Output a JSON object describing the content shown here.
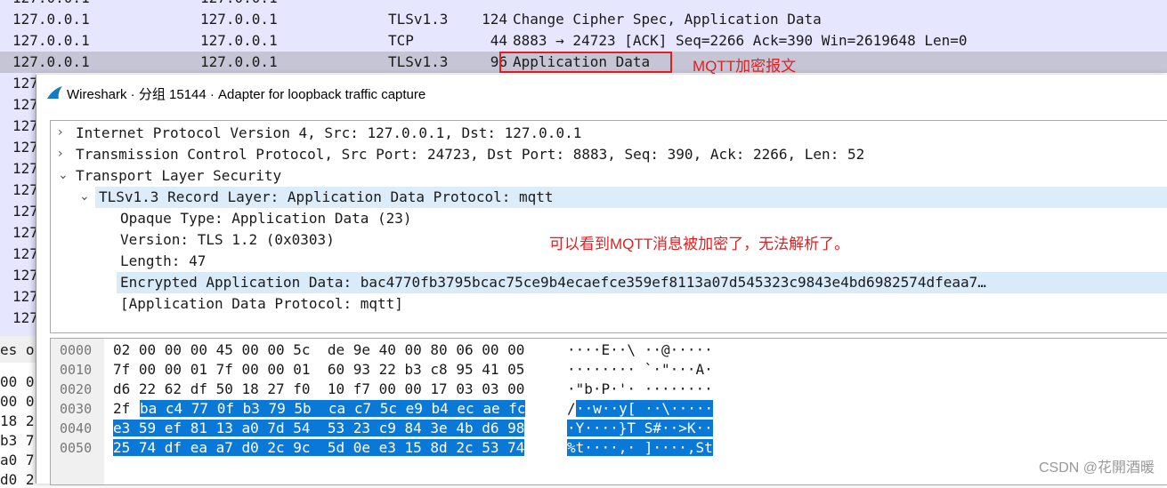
{
  "packet_list": {
    "rows": [
      {
        "src": "127.0.0.1",
        "dst": "127.0.0.1",
        "proto": "TLSv1.3",
        "len": "124",
        "info": "Change Cipher Spec, Application Data"
      },
      {
        "src": "127.0.0.1",
        "dst": "127.0.0.1",
        "proto": "TCP",
        "len": "44",
        "info": "8883 → 24723 [ACK] Seq=2266 Ack=390 Win=2619648 Len=0"
      },
      {
        "src": "127.0.0.1",
        "dst": "127.0.0.1",
        "proto": "TLSv1.3",
        "len": "96",
        "info": "Application Data"
      }
    ],
    "left_fragments": [
      "127",
      "127",
      "127",
      "127",
      "127",
      "127",
      "127",
      "127",
      "127",
      "127",
      "127"
    ],
    "bytes_fragments": [
      "es o",
      "00 0",
      "00 0",
      "18 2",
      "b3 7",
      "a0 7",
      "d0 2"
    ]
  },
  "annotations": {
    "mqtt_label": "MQTT加密报文",
    "encrypted_note": "可以看到MQTT消息被加密了，无法解析了。"
  },
  "dialog": {
    "title": "Wireshark · 分组 15144 · Adapter for loopback traffic capture"
  },
  "tree": [
    {
      "indent": 0,
      "chevron": "›",
      "text": "Internet Protocol Version 4, Src: 127.0.0.1, Dst: 127.0.0.1"
    },
    {
      "indent": 0,
      "chevron": "›",
      "text": "Transmission Control Protocol, Src Port: 24723, Dst Port: 8883, Seq: 390, Ack: 2266, Len: 52"
    },
    {
      "indent": 0,
      "chevron": "⌄",
      "text": "Transport Layer Security"
    },
    {
      "indent": 1,
      "chevron": "⌄",
      "text": "TLSv1.3 Record Layer: Application Data Protocol: mqtt"
    },
    {
      "indent": 2,
      "chevron": "",
      "text": "Opaque Type: Application Data (23)"
    },
    {
      "indent": 2,
      "chevron": "",
      "text": "Version: TLS 1.2 (0x0303)"
    },
    {
      "indent": 2,
      "chevron": "",
      "text": "Length: 47"
    },
    {
      "indent": 2,
      "chevron": "",
      "text": "Encrypted Application Data: bac4770fb3795bcac75ce9b4ecaefce359ef8113a07d545323c9843e4bd6982574dfeaa7…"
    },
    {
      "indent": 2,
      "chevron": "",
      "text": "[Application Data Protocol: mqtt]"
    }
  ],
  "bytes": {
    "offsets": [
      "0000",
      "0010",
      "0020",
      "0030",
      "0040",
      "0050"
    ],
    "hex_plain": [
      "02 00 00 00 45 00 00 5c  de 9e 40 00 80 06 00 00",
      "7f 00 00 01 7f 00 00 01  60 93 22 b3 c8 95 41 05",
      "d6 22 62 df 50 18 27 f0  10 f7 00 00 17 03 03 00",
      "2f",
      "",
      ""
    ],
    "hex_selected": [
      "",
      "",
      "",
      "ba c4 77 0f b3 79 5b  ca c7 5c e9 b4 ec ae fc",
      "e3 59 ef 81 13 a0 7d 54  53 23 c9 84 3e 4b d6 98",
      "25 74 df ea a7 d0 2c 9c  5d 0e e3 15 8d 2c 53 74"
    ],
    "ascii_plain": [
      "····E··\\ ··@·····",
      "········ `·\"···A·",
      "·\"b·P·'· ········",
      "/",
      "",
      ""
    ],
    "ascii_selected": [
      "",
      "",
      "",
      "··w··y[ ··\\·····",
      "·Y····}T S#··>K··",
      "%t····,· ]····,St"
    ]
  },
  "watermark": "CSDN @花開酒暖"
}
